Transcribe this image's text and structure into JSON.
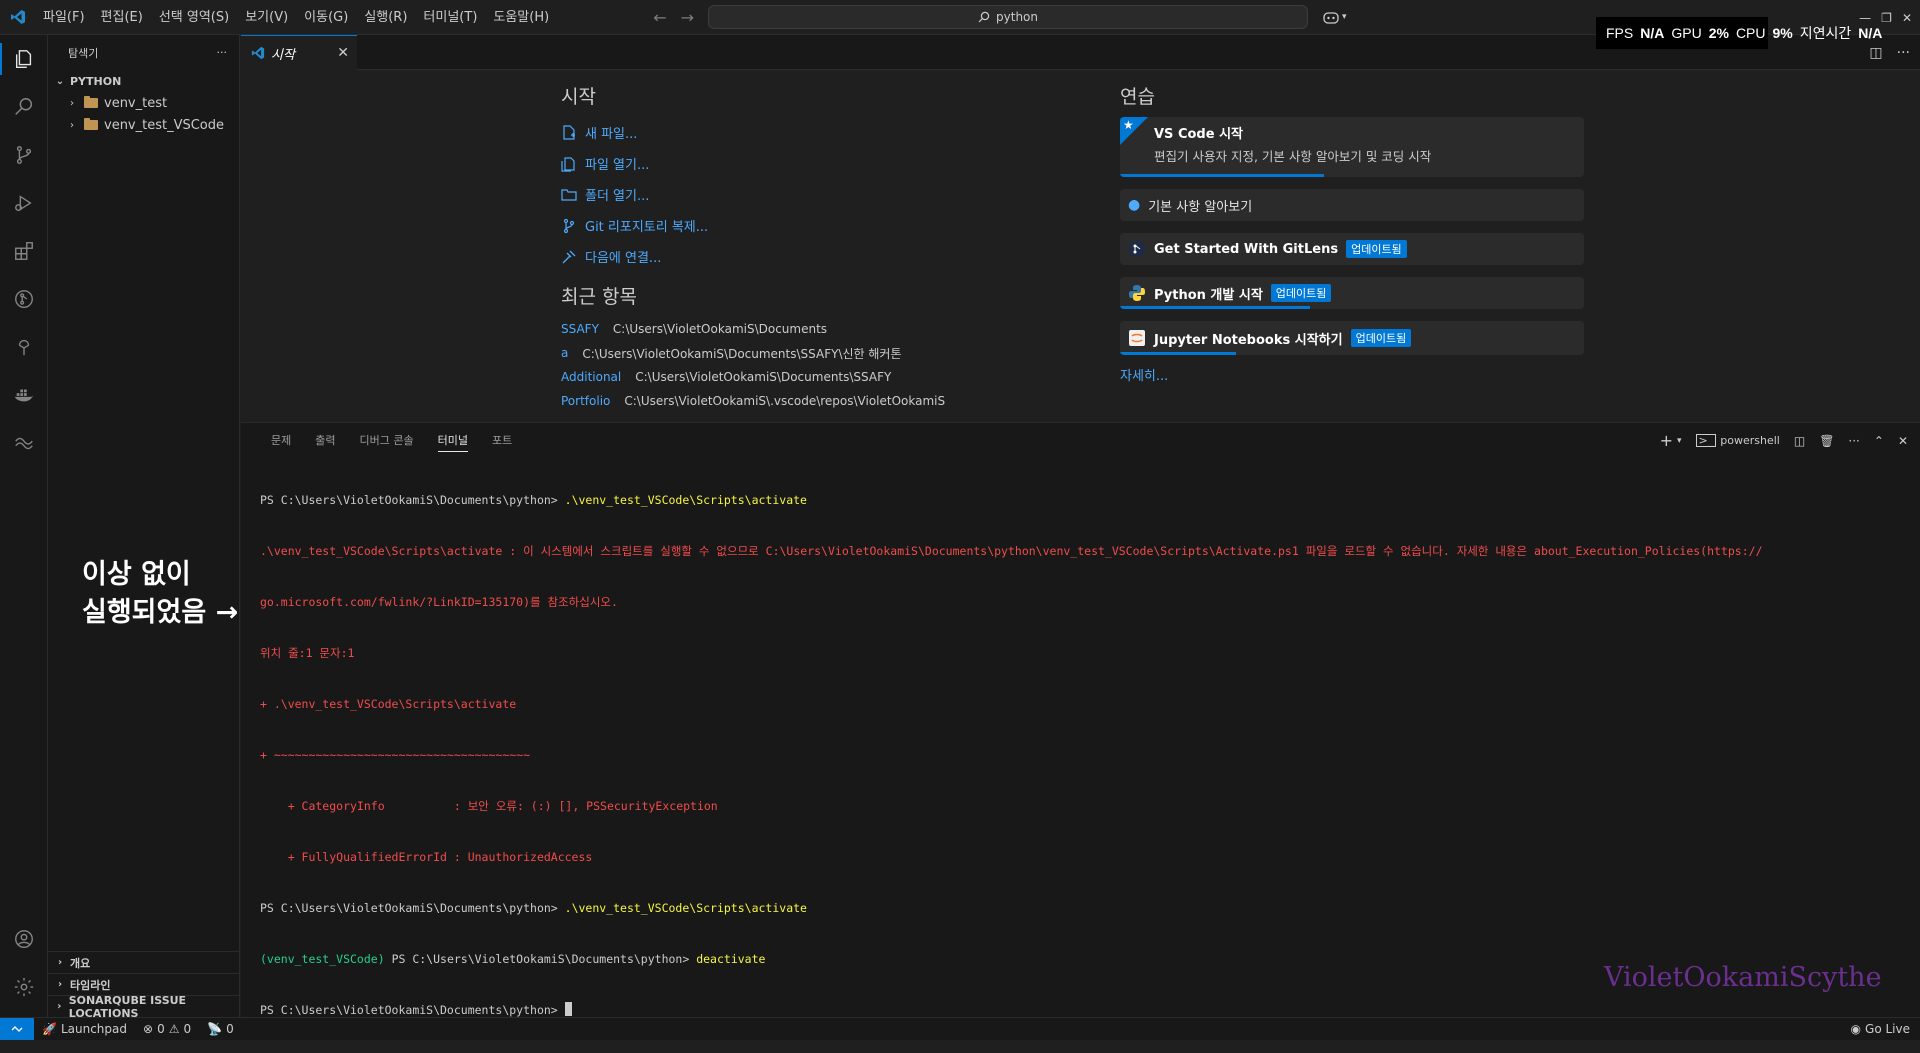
{
  "titlebar": {
    "menu": [
      "파일(F)",
      "편집(E)",
      "선택 영역(S)",
      "보기(V)",
      "이동(G)",
      "실행(R)",
      "터미널(T)",
      "도움말(H)"
    ],
    "search_text": "python"
  },
  "perf": {
    "fps_label": "FPS",
    "fps_value": "N/A",
    "gpu_label": "GPU",
    "gpu_value": "2%",
    "cpu_label": "CPU",
    "cpu_value": "9%",
    "latency_label": "지연시간",
    "latency_value": "N/A"
  },
  "sidebar": {
    "title": "탐색기",
    "root": "PYTHON",
    "folders": [
      "venv_test",
      "venv_test_VSCode"
    ],
    "bottom_sections": [
      "개요",
      "타임라인",
      "SONARQUBE ISSUE LOCATIONS"
    ]
  },
  "tab": {
    "label": "시작"
  },
  "welcome": {
    "start_heading": "시작",
    "start_items": [
      "새 파일...",
      "파일 열기...",
      "폴더 열기...",
      "Git 리포지토리 복제...",
      "다음에 연결..."
    ],
    "recent_heading": "최근 항목",
    "recent": [
      {
        "name": "SSAFY",
        "path": "C:\\Users\\VioletOokamiS\\Documents"
      },
      {
        "name": "a",
        "path": "C:\\Users\\VioletOokamiS\\Documents\\SSAFY\\신한 해커톤"
      },
      {
        "name": "Additional",
        "path": "C:\\Users\\VioletOokamiS\\Documents\\SSAFY"
      },
      {
        "name": "Portfolio",
        "path": "C:\\Users\\VioletOokamiS\\.vscode\\repos\\VioletOokamiS"
      }
    ],
    "walk_heading": "연습",
    "walkthroughs": [
      {
        "title": "VS Code 시작",
        "desc": "편집기 사용자 지정, 기본 사항 알아보기 및 코딩 시작",
        "progress": 0.44
      },
      {
        "title": "기본 사항 알아보기",
        "progress": 0
      },
      {
        "title": "Get Started With GitLens",
        "badge": "업데이트됨",
        "progress": 0
      },
      {
        "title": "Python 개발 시작",
        "badge": "업데이트됨",
        "progress": 0.41
      },
      {
        "title": "Jupyter Notebooks 시작하기",
        "badge": "업데이트됨",
        "progress": 0.25
      }
    ],
    "more": "자세히..."
  },
  "panel": {
    "tabs": [
      "문제",
      "출력",
      "디버그 콘솔",
      "터미널",
      "포트"
    ],
    "active_tab": 3,
    "shell": "powershell"
  },
  "terminal": {
    "l1_prompt": "PS C:\\Users\\VioletOokamiS\\Documents\\python> ",
    "l1_cmd": ".\\venv_test_VSCode\\Scripts\\activate",
    "l2": ".\\venv_test_VSCode\\Scripts\\activate : 이 시스템에서 스크립트를 실행할 수 없으므로 C:\\Users\\VioletOokamiS\\Documents\\python\\venv_test_VSCode\\Scripts\\Activate.ps1 파일을 로드할 수 없습니다. 자세한 내용은 about_Execution_Policies(https://",
    "l3": "go.microsoft.com/fwlink/?LinkID=135170)를 참조하십시오.",
    "l4": "위치 줄:1 문자:1",
    "l5": "+ .\\venv_test_VSCode\\Scripts\\activate",
    "l6": "+ ~~~~~~~~~~~~~~~~~~~~~~~~~~~~~~~~~~~~~",
    "l7": "    + CategoryInfo          : 보안 오류: (:) [], PSSecurityException",
    "l8": "    + FullyQualifiedErrorId : UnauthorizedAccess",
    "l9_prompt": "PS C:\\Users\\VioletOokamiS\\Documents\\python> ",
    "l9_cmd": ".\\venv_test_VSCode\\Scripts\\activate",
    "l10_env": "(venv_test_VSCode) ",
    "l10_prompt": "PS C:\\Users\\VioletOokamiS\\Documents\\python> ",
    "l10_cmd": "deactivate",
    "l11_prompt": "PS C:\\Users\\VioletOokamiS\\Documents\\python> "
  },
  "annotation": {
    "line1": "이상 없이",
    "line2": "실행되었음 →"
  },
  "watermark": "VioletOokamiScythe",
  "statusbar": {
    "launchpad": "Launchpad",
    "errors": "0",
    "warnings": "0",
    "ports": "0",
    "golive": "Go Live"
  },
  "colors": {
    "accent": "#0078d4",
    "link": "#4daafc",
    "error": "#f14c4c",
    "cmd": "#f5f543",
    "venv": "#23d18b"
  }
}
